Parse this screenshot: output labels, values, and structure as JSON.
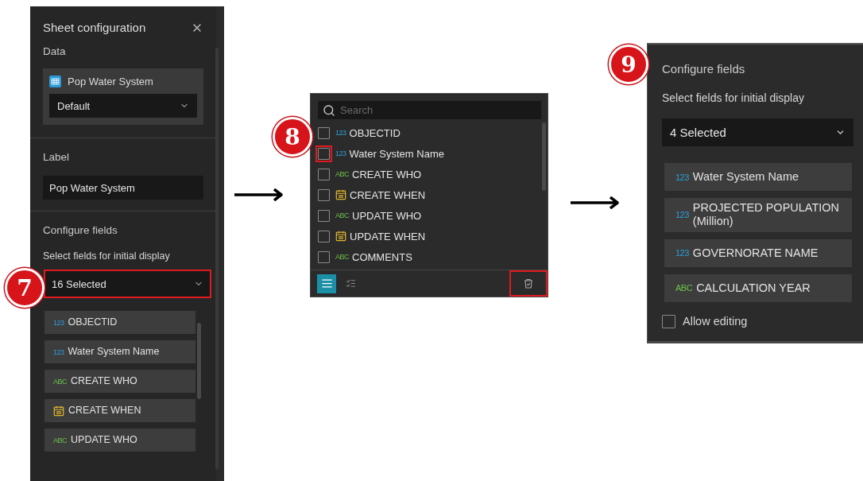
{
  "sheet_panel": {
    "step": "7",
    "title": "Sheet configuration",
    "data_heading": "Data",
    "data_source": {
      "name": "Pop Water System"
    },
    "view_select": {
      "value": "Default"
    },
    "label_heading": "Label",
    "label_input": {
      "value": "Pop Water System"
    },
    "fields_heading": "Configure fields",
    "fields_hint": "Select fields for initial display",
    "fields_select": {
      "value": "16 Selected",
      "highlighted": true
    },
    "fields": [
      {
        "kind": "number",
        "badge": "123",
        "label": "OBJECTID"
      },
      {
        "kind": "number",
        "badge": "123",
        "label": "Water System Name"
      },
      {
        "kind": "string",
        "badge": "ABC",
        "label": "CREATE WHO"
      },
      {
        "kind": "date",
        "label": "CREATE WHEN"
      },
      {
        "kind": "string",
        "badge": "ABC",
        "label": "UPDATE WHO"
      }
    ]
  },
  "field_picker": {
    "step": "8",
    "search": {
      "placeholder": "Search"
    },
    "options": [
      {
        "kind": "number",
        "badge": "123",
        "label": "OBJECTID",
        "checked": false,
        "highlighted": false
      },
      {
        "kind": "number",
        "badge": "123",
        "label": "Water System Name",
        "checked": false,
        "highlighted": true
      },
      {
        "kind": "string",
        "badge": "ABC",
        "label": "CREATE WHO",
        "checked": false,
        "highlighted": false
      },
      {
        "kind": "date",
        "label": "CREATE WHEN",
        "checked": false,
        "highlighted": false
      },
      {
        "kind": "string",
        "badge": "ABC",
        "label": "UPDATE WHO",
        "checked": false,
        "highlighted": false
      },
      {
        "kind": "date",
        "label": "UPDATE WHEN",
        "checked": false,
        "highlighted": false
      },
      {
        "kind": "string",
        "badge": "ABC",
        "label": "COMMENTS",
        "checked": false,
        "highlighted": false
      }
    ],
    "view_buttons": [
      {
        "kind": "list",
        "selected": true
      },
      {
        "kind": "checklist",
        "selected": false
      }
    ],
    "clear_button": {
      "highlighted": true
    }
  },
  "fields_panel": {
    "step": "9",
    "heading": "Configure fields",
    "hint": "Select fields for initial display",
    "fields_select": {
      "value": "4 Selected",
      "highlighted": false
    },
    "fields": [
      {
        "kind": "number",
        "badge": "123",
        "label": "Water System Name"
      },
      {
        "kind": "number",
        "badge": "123",
        "label": "PROJECTED POPULATION (Million)"
      },
      {
        "kind": "number",
        "badge": "123",
        "label": "GOVERNORATE NAME"
      },
      {
        "kind": "string",
        "badge": "ABC",
        "label": "CALCULATION YEAR"
      }
    ],
    "allow_editing": {
      "label": "Allow editing",
      "checked": false
    }
  }
}
